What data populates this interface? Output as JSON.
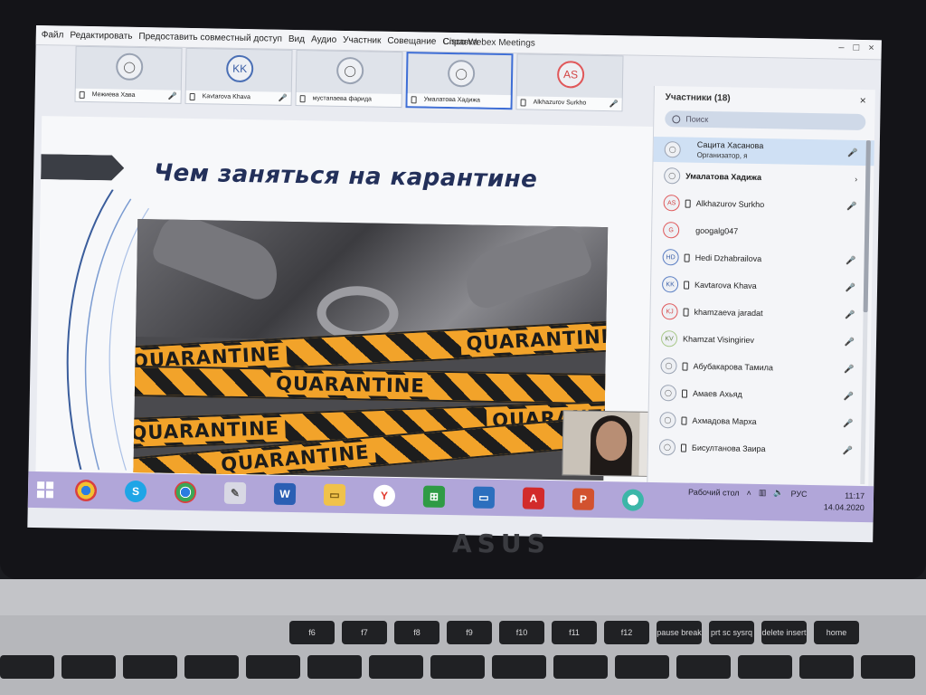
{
  "menu": {
    "items": [
      "Файл",
      "Редактировать",
      "Предоставить совместный доступ",
      "Вид",
      "Аудио",
      "Участник",
      "Совещание",
      "Справка"
    ],
    "window_title": "Cisco Webex Meetings",
    "connected": "Подключено"
  },
  "video_tiles": [
    {
      "initials": "",
      "name": "Межиева Хава"
    },
    {
      "initials": "KK",
      "name": "Kavtarova Khava"
    },
    {
      "initials": "",
      "name": "мустапаева фарида"
    },
    {
      "initials": "",
      "name": "Умалатова Хадижа"
    },
    {
      "initials": "AS",
      "name": "Alkhazurov Surkho"
    }
  ],
  "slide": {
    "title": "Чем заняться на карантине",
    "tape_text": "QUARANTINE"
  },
  "participants": {
    "header": "Участники (18)",
    "search_placeholder": "Поиск",
    "list": [
      {
        "initials": "",
        "name": "Сацита Хасанова",
        "role": "Организатор, я",
        "color": "gray"
      },
      {
        "initials": "",
        "name": "Умалатова Хадижа",
        "role": "",
        "color": "gray"
      },
      {
        "initials": "AS",
        "name": "Alkhazurov Surkho",
        "role": "",
        "color": "red"
      },
      {
        "initials": "G",
        "name": "googalg047",
        "role": "",
        "color": "red"
      },
      {
        "initials": "HD",
        "name": "Hedi Dzhabrailova",
        "role": "",
        "color": "blue"
      },
      {
        "initials": "KK",
        "name": "Kavtarova Khava",
        "role": "",
        "color": "blue"
      },
      {
        "initials": "KJ",
        "name": "khamzaeva jaradat",
        "role": "",
        "color": "red"
      },
      {
        "initials": "KV",
        "name": "Khamzat Visingiriev",
        "role": "",
        "color": "green"
      },
      {
        "initials": "",
        "name": "Абубакарова Тамила",
        "role": "",
        "color": "gray"
      },
      {
        "initials": "",
        "name": "Амаев Ахьяд",
        "role": "",
        "color": "gray"
      },
      {
        "initials": "",
        "name": "Ахмадова Марха",
        "role": "",
        "color": "gray"
      },
      {
        "initials": "",
        "name": "Бисултанова Заира",
        "role": "",
        "color": "gray"
      }
    ]
  },
  "taskbar": {
    "desktop_label": "Рабочий стол",
    "lang": "РУС",
    "time": "11:17",
    "date": "14.04.2020",
    "apps": [
      "chrome-icon",
      "skype-icon",
      "chrome-icon",
      "paint-icon",
      "word-icon",
      "explorer-icon",
      "yandex-icon",
      "store-icon",
      "monitor-icon",
      "acrobat-icon",
      "powerpoint-icon",
      "webex-icon"
    ]
  },
  "laptop": {
    "brand": "ASUS",
    "keys": [
      "f6",
      "f7",
      "f8",
      "f9",
      "f10",
      "f11",
      "f12",
      "pause break",
      "prt sc sysrq",
      "delete insert",
      "home"
    ]
  },
  "colors": {
    "taskbar": "#b1a6d9",
    "accent": "#3e6ed6",
    "tape": "#f2a32a",
    "slide_title": "#23305a"
  }
}
